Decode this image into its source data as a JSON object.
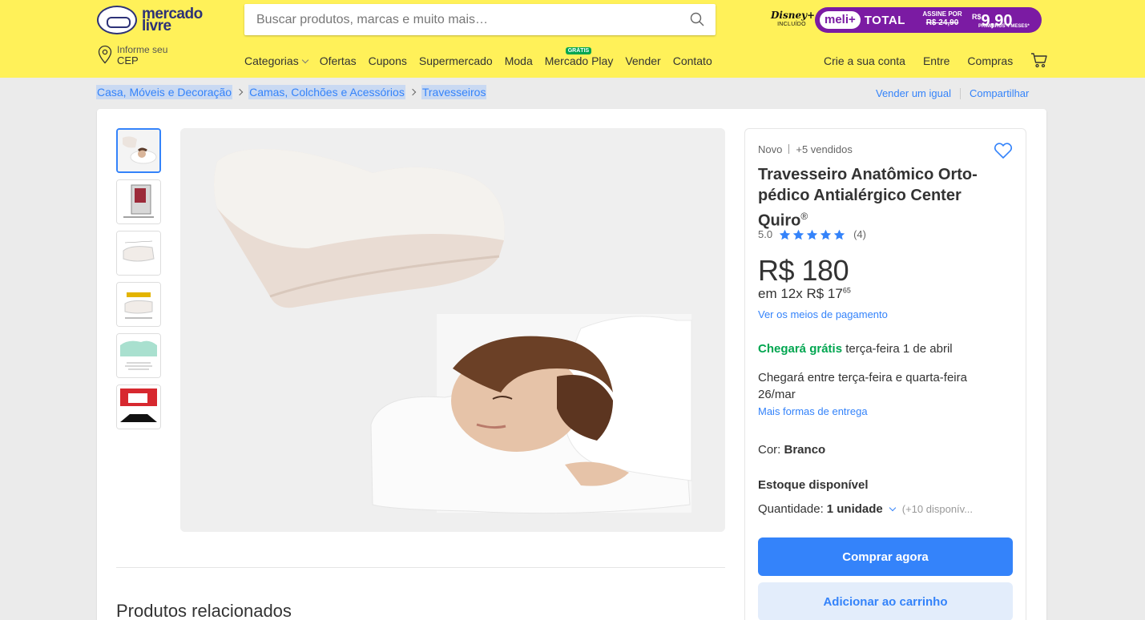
{
  "header": {
    "logo_line1": "mercado",
    "logo_line2": "livre",
    "search_placeholder": "Buscar produtos, marcas e muito mais…",
    "disney_line1": "Disney+",
    "disney_line2": "INCLUÍDO",
    "meli_plus": "meli+",
    "meli_total": "TOTAL",
    "meli_assine": "ASSINE POR",
    "meli_old_price": "R$ 24,90",
    "meli_currency": "R$",
    "meli_price": "9,90",
    "meli_sub": "PRIMEIROS 4 MESES*",
    "cep_line1": "Informe seu",
    "cep_line2": "CEP",
    "nav": {
      "categorias": "Categorias",
      "ofertas": "Ofertas",
      "cupons": "Cupons",
      "supermercado": "Supermercado",
      "moda": "Moda",
      "mercado_play": "Mercado Play",
      "gratis_badge": "GRÁTIS",
      "vender": "Vender",
      "contato": "Contato"
    },
    "account": {
      "crie_conta": "Crie a sua conta",
      "entre": "Entre",
      "compras": "Compras"
    }
  },
  "breadcrumb": {
    "items": [
      "Casa, Móveis e Decoração",
      "Camas, Colchões e Acessórios",
      "Travesseiros"
    ],
    "vender_igual": "Vender um igual",
    "compartilhar": "Compartilhar"
  },
  "product": {
    "condition": "Novo",
    "sold": "+5 vendidos",
    "title": "Travesseiro Anatômico Orto-pédico Antialérgico Center Quiro",
    "title_reg": "®",
    "rating": "5.0",
    "stars": 5,
    "reviews": "(4)",
    "price": "R$ 180",
    "installments": "em 12x R$ 17",
    "installments_cents": "65",
    "payment_link": "Ver os meios de pagamento",
    "ship_free": "Chegará grátis",
    "ship_date": " terça-feira 1 de abril",
    "ship_range": "Chegará entre terça-feira e quarta-feira 26/mar",
    "ship_more": "Mais formas de entrega",
    "color_label": "Cor:",
    "color_value": "Branco",
    "stock": "Estoque disponível",
    "qty_label": "Quantidade:",
    "qty_value": "1 unidade",
    "qty_available": "(+10 disponív...",
    "buy_now": "Comprar agora",
    "add_cart": "Adicionar ao carrinho"
  },
  "related_title": "Produtos relacionados",
  "colors": {
    "header_yellow": "#fff159",
    "accent_blue": "#3483fa",
    "green": "#00a650",
    "meli_purple": "#7b1ba3"
  }
}
